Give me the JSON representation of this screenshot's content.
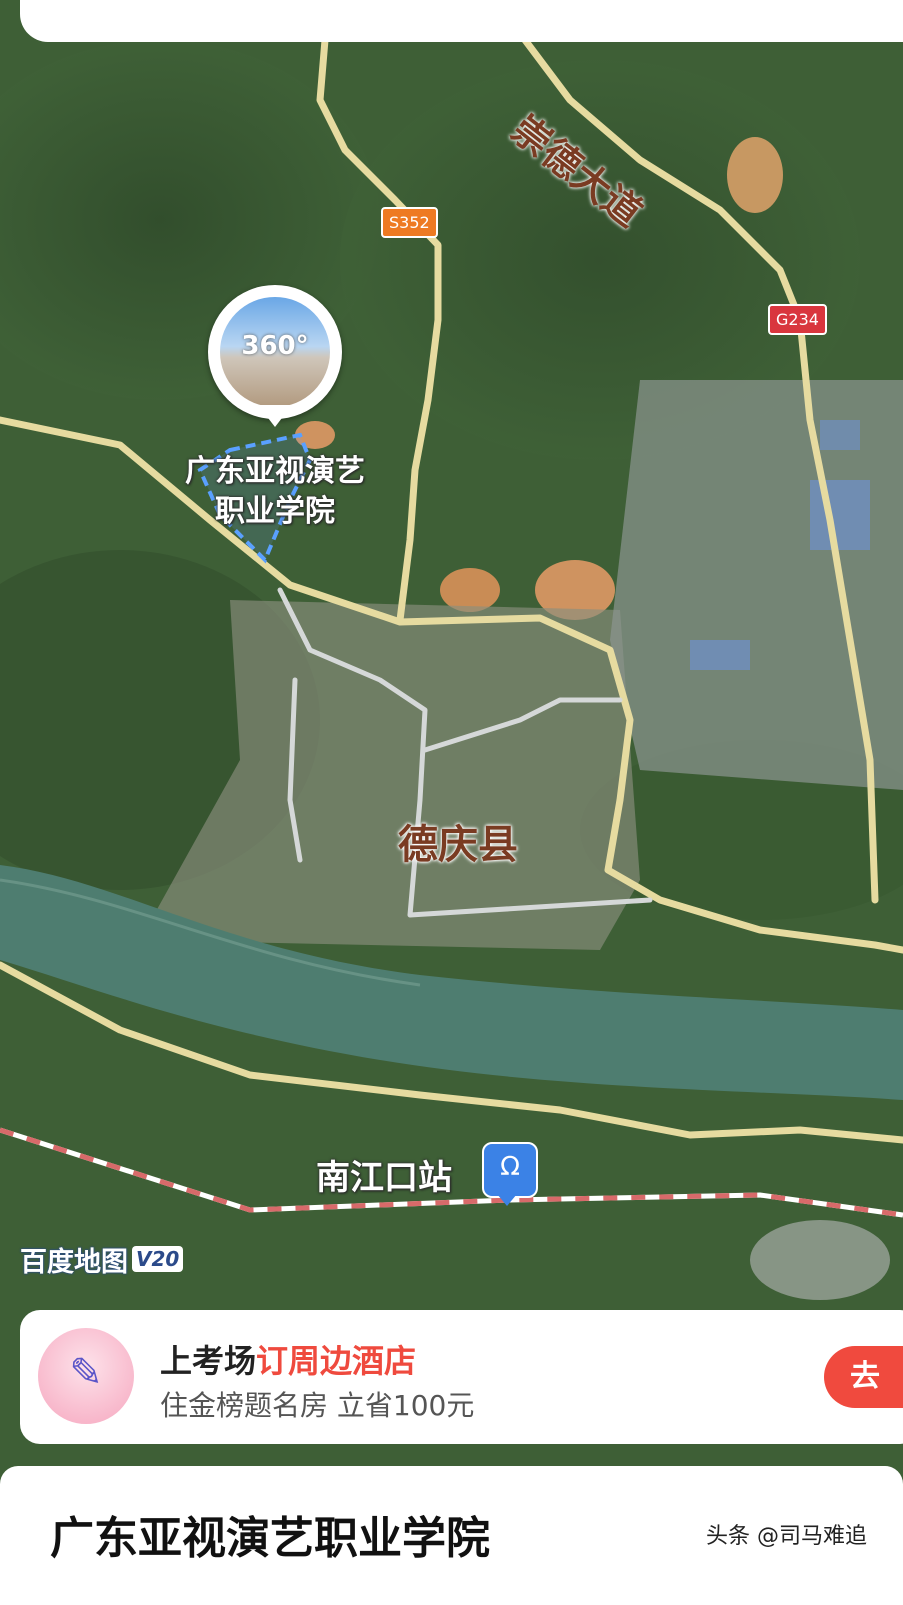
{
  "map": {
    "avenue_label": "崇德大道",
    "route_s352": "S352",
    "route_g234": "G234",
    "poi_label_line1": "广东亚视演艺",
    "poi_label_line2": "职业学院",
    "panorama_badge": "360°",
    "county_label": "德庆县",
    "station_label": "南江口站",
    "station_icon_glyph": "Ω",
    "brand_logo": "百度地图",
    "brand_version": "V20"
  },
  "ad": {
    "title_prefix": "上考场",
    "title_highlight": "订周边酒店",
    "subtitle": "住金榜题名房 立省100元",
    "button_label": "去",
    "icon_glyph": "✎",
    "highlight_color": "#ef4a3e"
  },
  "bottom_sheet": {
    "place_name": "广东亚视演艺职业学院",
    "watermark": "头条 @司马难追"
  }
}
